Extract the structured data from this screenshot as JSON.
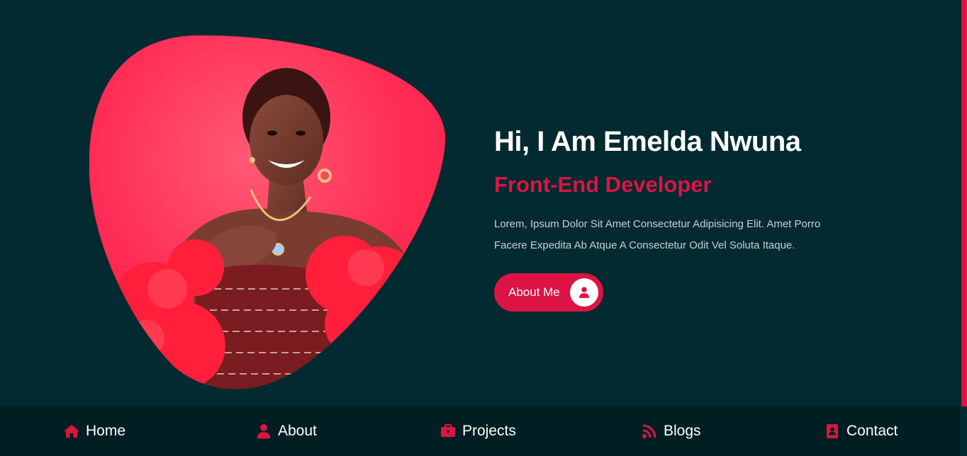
{
  "hero": {
    "greeting": "Hi, I Am Emelda Nwuna",
    "role": "Front-End Developer",
    "description_line1": "Lorem, Ipsum Dolor Sit Amet Consectetur Adipisicing Elit. Amet Porro",
    "description_line2": "Facere Expedita Ab Atque A Consectetur Odit Vel Soluta Itaque.",
    "button_label": "About Me",
    "button_icon": "user-icon",
    "image": "portrait-photo"
  },
  "nav": {
    "items": [
      {
        "label": "Home",
        "icon": "home-icon"
      },
      {
        "label": "About",
        "icon": "user-icon"
      },
      {
        "label": "Projects",
        "icon": "briefcase-icon"
      },
      {
        "label": "Blogs",
        "icon": "rss-icon"
      },
      {
        "label": "Contact",
        "icon": "address-book-icon"
      }
    ]
  },
  "colors": {
    "background": "#022a30",
    "nav_background": "#011f22",
    "accent": "#dc1443",
    "text": "#ffffff",
    "muted_text": "#c9d0d2"
  }
}
